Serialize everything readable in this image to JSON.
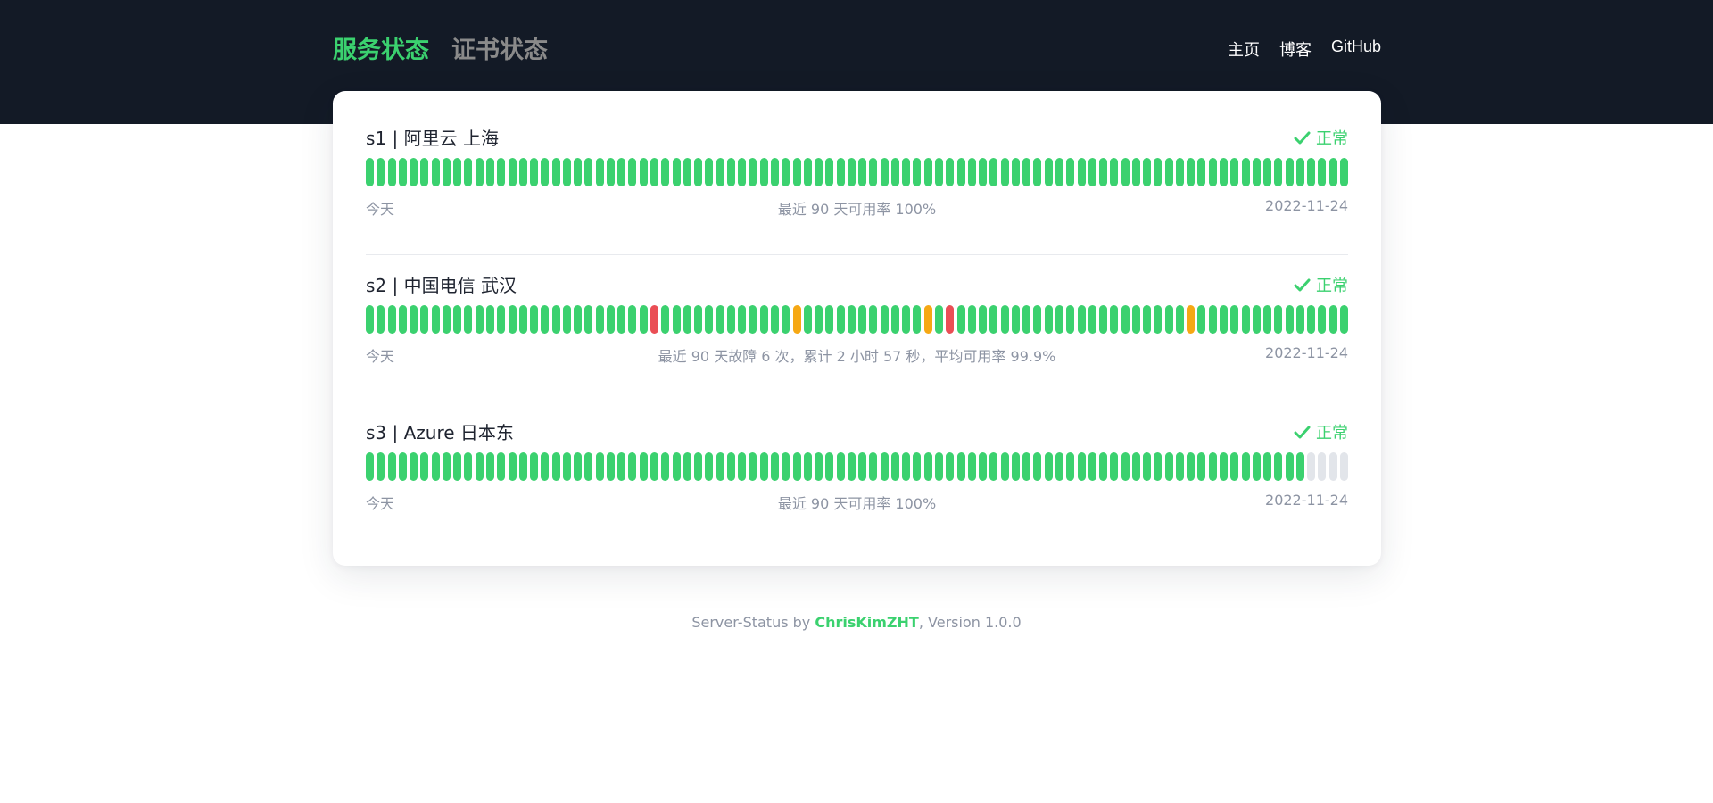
{
  "header": {
    "tabs": [
      {
        "label": "服务状态",
        "active": true
      },
      {
        "label": "证书状态",
        "active": false
      }
    ],
    "links": [
      {
        "label": "主页"
      },
      {
        "label": "博客"
      },
      {
        "label": "GitHub"
      }
    ]
  },
  "monitors": [
    {
      "name": "s1 | 阿里云 上海",
      "status": "正常",
      "left_label": "今天",
      "summary": "最近 90 天可用率 100%",
      "right_label": "2022-11-24",
      "days": "oooooooooooooooooooooooooooooooooooooooooooooooooooooooooooooooooooooooooooooooooooooooooo"
    },
    {
      "name": "s2 | 中国电信 武汉",
      "status": "正常",
      "left_label": "今天",
      "summary": "最近 90 天故障 6 次，累计 2 小时 57 秒，平均可用率 99.9%",
      "right_label": "2022-11-24",
      "days": "oooooooooooooooooooooooooodoooooooooooowooooooooooowodooooooooooooooooooooowoooooooooooooo"
    },
    {
      "name": "s3 | Azure 日本东",
      "status": "正常",
      "left_label": "今天",
      "summary": "最近 90 天可用率 100%",
      "right_label": "2022-11-24",
      "days": "oooooooooooooooooooooooooooooooooooooooooooooooooooooooooooooooooooooooooooooooooooooonnnn"
    }
  ],
  "footer": {
    "prefix": "Server-Status by ",
    "author": "ChrisKimZHT",
    "suffix": ", Version 1.0.0"
  },
  "colors": {
    "accent": "#3bd16f",
    "ok": "#3bd16f",
    "warning": "#f6a814",
    "down": "#ea4e55",
    "no_data": "#e2e5ea",
    "header_bg": "#131a26"
  },
  "legend_codes": {
    "o": "ok",
    "w": "warning",
    "d": "down",
    "n": "no data"
  }
}
